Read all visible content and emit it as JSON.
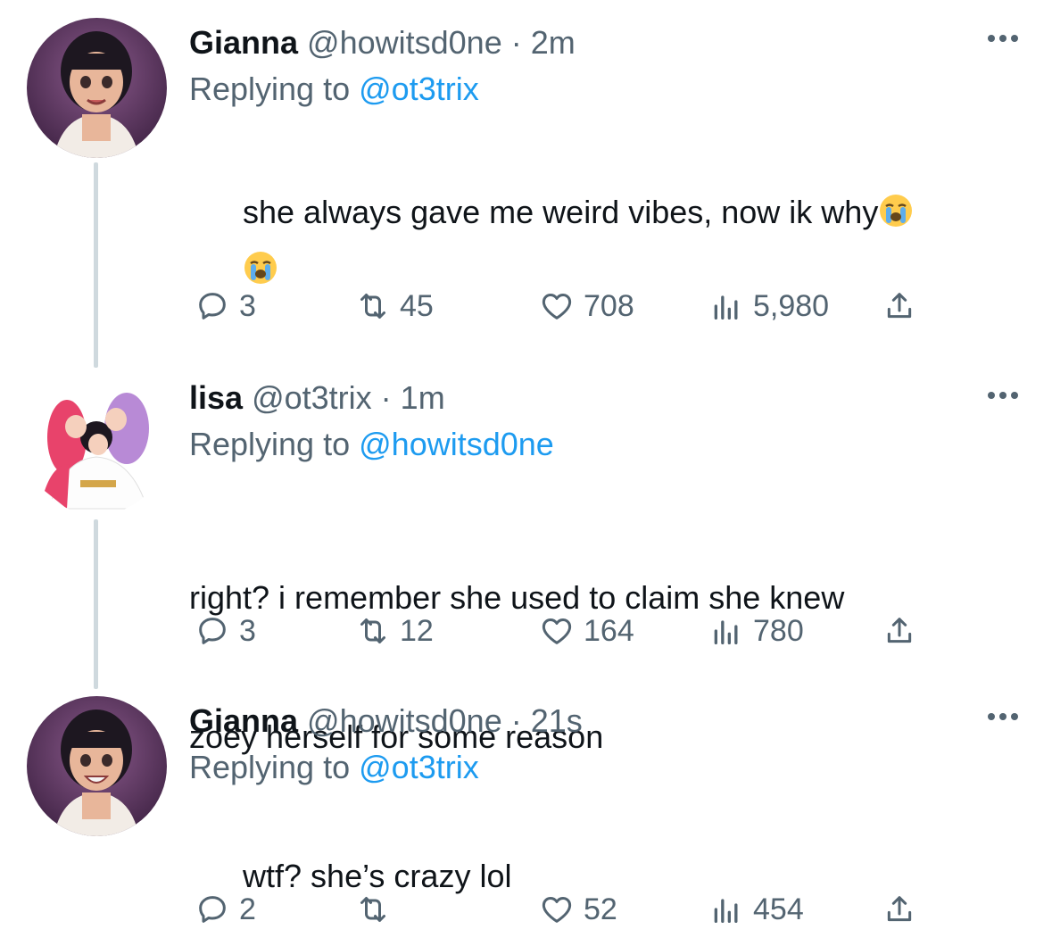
{
  "colors": {
    "link": "#1d9bf0",
    "muted": "#536471",
    "text": "#0f1419",
    "thread_line": "#cfd9de"
  },
  "reply_prefix": "Replying to",
  "tweets": [
    {
      "name": "Gianna",
      "handle": "@howitsd0ne",
      "separator": "·",
      "time": "2m",
      "replying_to": "@ot3trix",
      "text": "she always gave me weird vibes, now ik why",
      "emoji_trailing": "loudly-crying-face",
      "stats": {
        "replies": "3",
        "retweets": "45",
        "likes": "708",
        "views": "5,980"
      }
    },
    {
      "name": "lisa",
      "handle": "@ot3trix",
      "separator": "·",
      "time": "1m",
      "replying_to": "@howitsd0ne",
      "text_line1": "right? i remember she used to claim she knew",
      "text_line2": "zoey herself for some reason",
      "stats": {
        "replies": "3",
        "retweets": "12",
        "likes": "164",
        "views": "780"
      }
    },
    {
      "name": "Gianna",
      "handle": "@howitsd0ne",
      "separator": "·",
      "time": "21s",
      "replying_to": "@ot3trix",
      "text": "wtf? she’s crazy lol",
      "stats": {
        "replies": "2",
        "retweets": "",
        "likes": "52",
        "views": "454"
      }
    }
  ]
}
